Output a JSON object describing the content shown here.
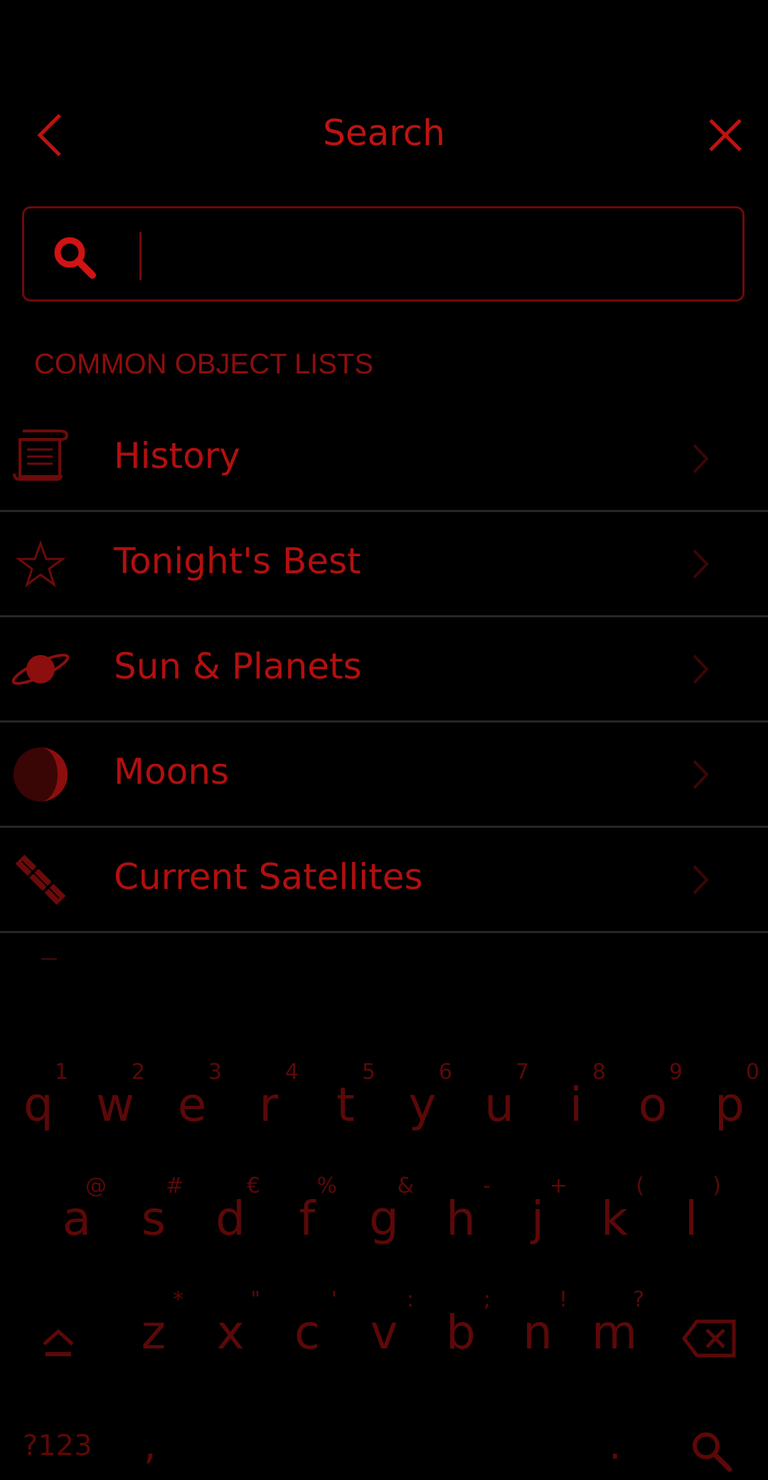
{
  "header": {
    "title": "Search"
  },
  "search": {
    "placeholder": "",
    "value": ""
  },
  "section": {
    "title": "COMMON OBJECT LISTS"
  },
  "list": [
    {
      "label": "History",
      "icon": "scroll-icon"
    },
    {
      "label": "Tonight's Best",
      "icon": "star-icon"
    },
    {
      "label": "Sun & Planets",
      "icon": "planet-icon"
    },
    {
      "label": "Moons",
      "icon": "moon-icon"
    },
    {
      "label": "Current Satellites",
      "icon": "satellite-icon"
    }
  ],
  "keyboard": {
    "row1": [
      {
        "ch": "q",
        "hint": "1"
      },
      {
        "ch": "w",
        "hint": "2"
      },
      {
        "ch": "e",
        "hint": "3"
      },
      {
        "ch": "r",
        "hint": "4"
      },
      {
        "ch": "t",
        "hint": "5"
      },
      {
        "ch": "y",
        "hint": "6"
      },
      {
        "ch": "u",
        "hint": "7"
      },
      {
        "ch": "i",
        "hint": "8"
      },
      {
        "ch": "o",
        "hint": "9"
      },
      {
        "ch": "p",
        "hint": "0"
      }
    ],
    "row2": [
      {
        "ch": "a",
        "hint": "@"
      },
      {
        "ch": "s",
        "hint": "#"
      },
      {
        "ch": "d",
        "hint": "€"
      },
      {
        "ch": "f",
        "hint": "%"
      },
      {
        "ch": "g",
        "hint": "&"
      },
      {
        "ch": "h",
        "hint": "-"
      },
      {
        "ch": "j",
        "hint": "+"
      },
      {
        "ch": "k",
        "hint": "("
      },
      {
        "ch": "l",
        "hint": ")"
      }
    ],
    "row3": [
      {
        "ch": "z",
        "hint": "*"
      },
      {
        "ch": "x",
        "hint": "\""
      },
      {
        "ch": "c",
        "hint": "'"
      },
      {
        "ch": "v",
        "hint": ":"
      },
      {
        "ch": "b",
        "hint": ";"
      },
      {
        "ch": "n",
        "hint": "!"
      },
      {
        "ch": "m",
        "hint": "?"
      }
    ],
    "symbols_label": "?123",
    "comma": ",",
    "period": "."
  },
  "colors": {
    "accent": "#c01212",
    "dim": "#5c0808",
    "divider": "#262626",
    "background": "#000000"
  }
}
